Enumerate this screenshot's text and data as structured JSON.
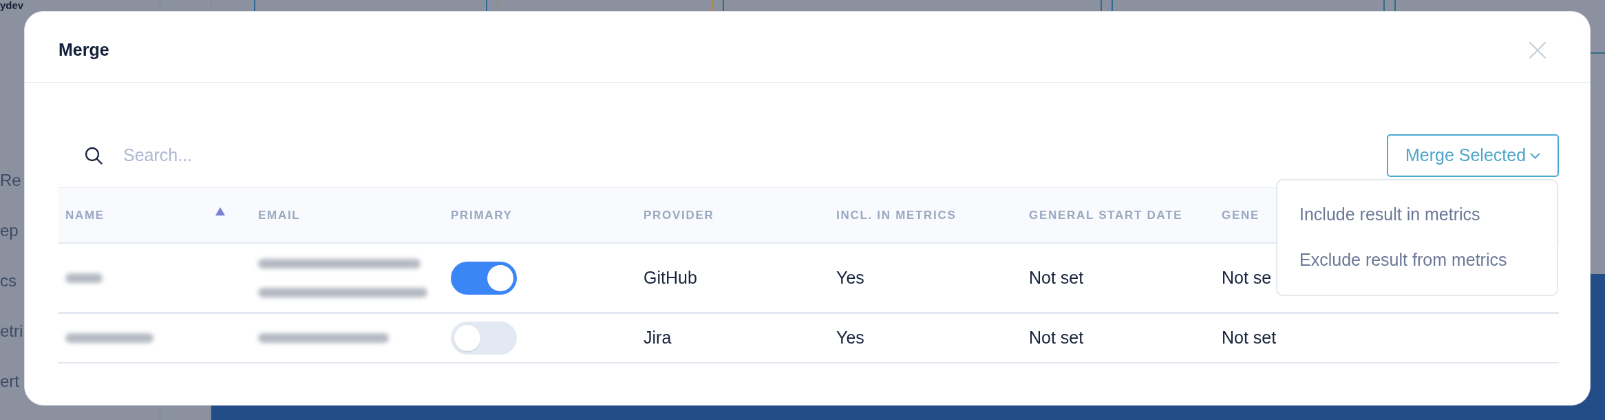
{
  "background": {
    "logo": "ydev",
    "sidebar_items": [
      "Re",
      "ep",
      "cs",
      "etri",
      "ert"
    ]
  },
  "dialog": {
    "title": "Merge",
    "search": {
      "placeholder": "Search..."
    },
    "merge_button": {
      "label": "Merge Selected",
      "expanded": true
    },
    "menu": {
      "items": [
        "Include result in metrics",
        "Exclude result from metrics"
      ]
    },
    "table": {
      "columns": [
        {
          "label": "NAME",
          "sorted": true
        },
        {
          "label": "EMAIL",
          "sorted": false
        },
        {
          "label": "PRIMARY",
          "sorted": false
        },
        {
          "label": "PROVIDER",
          "sorted": false
        },
        {
          "label": "INCL. IN METRICS",
          "sorted": false
        },
        {
          "label": "GENERAL START DATE",
          "sorted": false
        },
        {
          "label": "GENE",
          "sorted": false
        }
      ],
      "rows": [
        {
          "name": {
            "kind": "blurred-short"
          },
          "email": {
            "kind": "blurred-two-lines"
          },
          "primary": true,
          "provider": "GitHub",
          "incl_in_metrics": "Yes",
          "general_start_date": "Not set",
          "column_7": "Not se"
        },
        {
          "name": {
            "kind": "blurred-long"
          },
          "email": {
            "kind": "blurred-one-line"
          },
          "primary": false,
          "provider": "Jira",
          "incl_in_metrics": "Yes",
          "general_start_date": "Not set",
          "column_7": "Not set"
        }
      ]
    }
  }
}
